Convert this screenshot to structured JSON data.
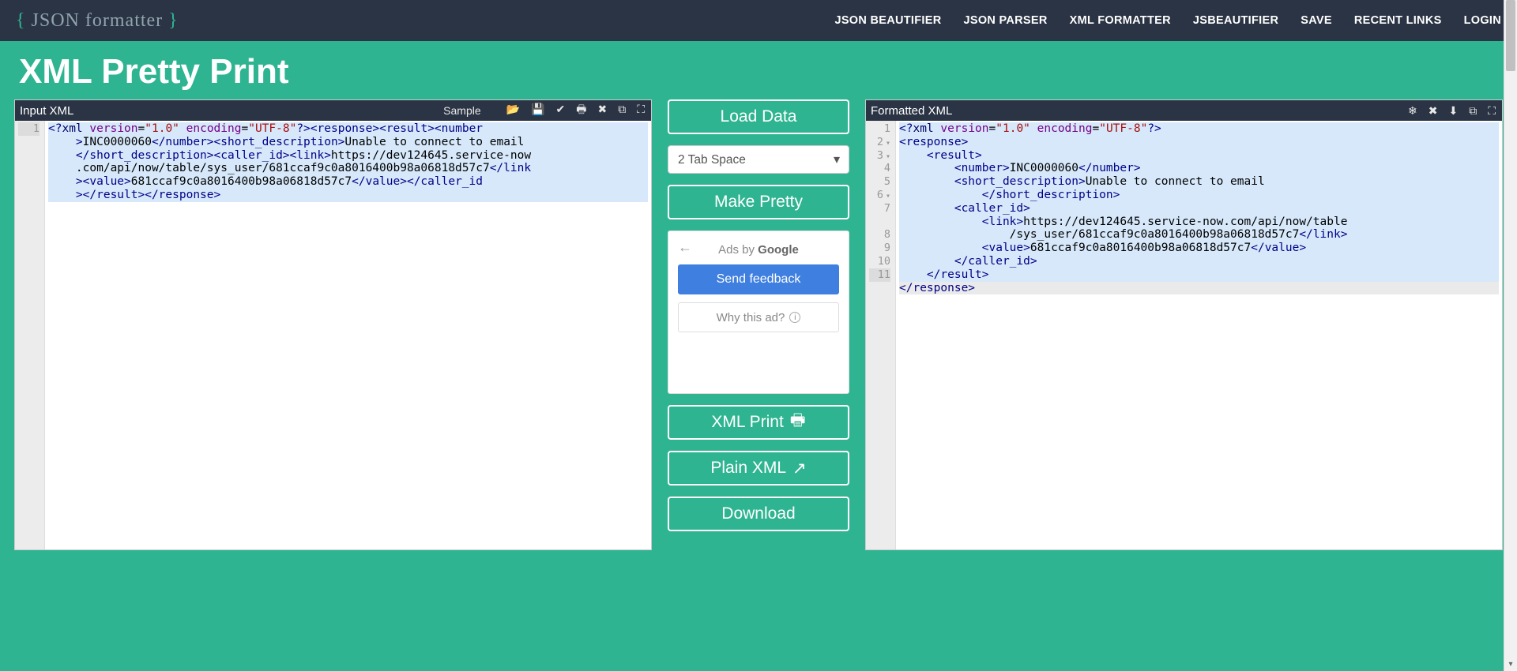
{
  "brand": {
    "open_brace": "{",
    "name": "JSON formatter",
    "close_brace": "}"
  },
  "nav": [
    "JSON BEAUTIFIER",
    "JSON PARSER",
    "XML FORMATTER",
    "JSBEAUTIFIER",
    "SAVE",
    "RECENT LINKS",
    "LOGIN"
  ],
  "page_title": "XML Pretty Print",
  "left_panel": {
    "title": "Input XML",
    "sample_label": "Sample",
    "toolbar_icons": [
      "folder-open-icon",
      "save-icon",
      "check-icon",
      "print-icon",
      "clear-icon",
      "copy-icon",
      "fullscreen-icon"
    ],
    "line_numbers": [
      "1"
    ],
    "code_tokens": [
      [
        {
          "cls": "t-tag",
          "t": "<?"
        },
        {
          "cls": "t-pi",
          "t": "xml"
        },
        {
          "cls": "",
          "t": " "
        },
        {
          "cls": "t-attr",
          "t": "version"
        },
        {
          "cls": "",
          "t": "="
        },
        {
          "cls": "t-str",
          "t": "\"1.0\""
        },
        {
          "cls": "",
          "t": " "
        },
        {
          "cls": "t-attr",
          "t": "encoding"
        },
        {
          "cls": "",
          "t": "="
        },
        {
          "cls": "t-str",
          "t": "\"UTF-8\""
        },
        {
          "cls": "t-tag",
          "t": "?>"
        },
        {
          "cls": "t-tag",
          "t": "<response><result><number"
        }
      ],
      [
        {
          "cls": "t-tag",
          "t": "    >"
        },
        {
          "cls": "t-text",
          "t": "INC0000060"
        },
        {
          "cls": "t-tag",
          "t": "</number><short_description>"
        },
        {
          "cls": "t-text",
          "t": "Unable to connect to email"
        }
      ],
      [
        {
          "cls": "t-tag",
          "t": "    </short_description><caller_id><link>"
        },
        {
          "cls": "t-text",
          "t": "https://dev124645.service-now"
        }
      ],
      [
        {
          "cls": "t-text",
          "t": "    .com/api/now/table/sys_user/681ccaf9c0a8016400b98a06818d57c7"
        },
        {
          "cls": "t-tag",
          "t": "</link"
        }
      ],
      [
        {
          "cls": "t-tag",
          "t": "    ><value>"
        },
        {
          "cls": "t-text",
          "t": "681ccaf9c0a8016400b98a06818d57c7"
        },
        {
          "cls": "t-tag",
          "t": "</value></caller_id"
        }
      ],
      [
        {
          "cls": "t-tag",
          "t": "    ></result></response>"
        }
      ]
    ]
  },
  "center": {
    "load": "Load Data",
    "tab_space_selected": "2 Tab Space",
    "make_pretty": "Make Pretty",
    "xml_print": "XML Print",
    "plain_xml": "Plain XML",
    "download": "Download",
    "ad": {
      "adsby": "Ads by ",
      "google": "Google",
      "send_feedback": "Send feedback",
      "why": "Why this ad?"
    }
  },
  "right_panel": {
    "title": "Formatted XML",
    "toolbar_icons": [
      "tree-icon",
      "clear-icon",
      "download-icon",
      "copy-icon",
      "fullscreen-icon"
    ],
    "line_numbers": [
      "1",
      "2",
      "3",
      "4",
      "5",
      "6",
      "7",
      "",
      "8",
      "9",
      "10",
      "11"
    ],
    "fold_rows": [
      1,
      2,
      5
    ],
    "code_tokens": [
      [
        {
          "cls": "t-tag",
          "t": "<?"
        },
        {
          "cls": "t-pi",
          "t": "xml"
        },
        {
          "cls": "",
          "t": " "
        },
        {
          "cls": "t-attr",
          "t": "version"
        },
        {
          "cls": "",
          "t": "="
        },
        {
          "cls": "t-str",
          "t": "\"1.0\""
        },
        {
          "cls": "",
          "t": " "
        },
        {
          "cls": "t-attr",
          "t": "encoding"
        },
        {
          "cls": "",
          "t": "="
        },
        {
          "cls": "t-str",
          "t": "\"UTF-8\""
        },
        {
          "cls": "t-tag",
          "t": "?>"
        }
      ],
      [
        {
          "cls": "t-tag",
          "t": "<response>"
        }
      ],
      [
        {
          "cls": "t-tag",
          "t": "    <result>"
        }
      ],
      [
        {
          "cls": "t-tag",
          "t": "        <number>"
        },
        {
          "cls": "t-text",
          "t": "INC0000060"
        },
        {
          "cls": "t-tag",
          "t": "</number>"
        }
      ],
      [
        {
          "cls": "t-tag",
          "t": "        <short_description>"
        },
        {
          "cls": "t-text",
          "t": "Unable to connect to email"
        }
      ],
      [
        {
          "cls": "t-tag",
          "t": "            </short_description>"
        }
      ],
      [
        {
          "cls": "t-tag",
          "t": "        <caller_id>"
        }
      ],
      [
        {
          "cls": "t-tag",
          "t": "            <link>"
        },
        {
          "cls": "t-text",
          "t": "https://dev124645.service-now.com/api/now/table"
        }
      ],
      [
        {
          "cls": "t-text",
          "t": "                /sys_user/681ccaf9c0a8016400b98a06818d57c7"
        },
        {
          "cls": "t-tag",
          "t": "</link>"
        }
      ],
      [
        {
          "cls": "t-tag",
          "t": "            <value>"
        },
        {
          "cls": "t-text",
          "t": "681ccaf9c0a8016400b98a06818d57c7"
        },
        {
          "cls": "t-tag",
          "t": "</value>"
        }
      ],
      [
        {
          "cls": "t-tag",
          "t": "        </caller_id>"
        }
      ],
      [
        {
          "cls": "t-tag",
          "t": "    </result>"
        }
      ],
      [
        {
          "cls": "t-tag",
          "t": "</response>"
        }
      ]
    ]
  },
  "icon_glyphs": {
    "folder-open-icon": "📂",
    "save-icon": "💾",
    "check-icon": "✔",
    "print-icon": "🖶",
    "clear-icon": "✖",
    "copy-icon": "⧉",
    "fullscreen-icon": "⛶",
    "tree-icon": "❄",
    "download-icon": "⬇",
    "external-icon": "↗"
  }
}
